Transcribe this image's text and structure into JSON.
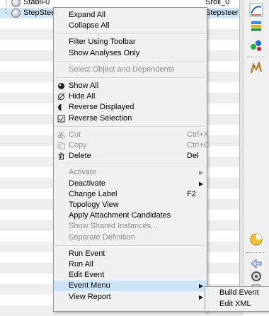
{
  "tree": {
    "rows": [
      {
        "name": "Stabil-0",
        "col": "Sroll_0"
      },
      {
        "name": "StepSteer",
        "col": "Stepsteer"
      }
    ]
  },
  "menu": {
    "groups": [
      [
        {
          "label": "Expand All",
          "enabled": true
        },
        {
          "label": "Collapse All",
          "enabled": true
        }
      ],
      [
        {
          "label": "Filter Using Toolbar",
          "enabled": true
        },
        {
          "label": "Show Analyses Only",
          "enabled": true
        }
      ],
      [
        {
          "label": "Select Object and Dependents",
          "enabled": false
        }
      ],
      [
        {
          "label": "Show All",
          "enabled": true,
          "icon": "show-all-icon"
        },
        {
          "label": "Hide All",
          "enabled": true,
          "icon": "hide-all-icon"
        },
        {
          "label": "Reverse Displayed",
          "enabled": true,
          "icon": "reverse-displayed-icon"
        },
        {
          "label": "Reverse Selection",
          "enabled": true,
          "icon": "reverse-selection-icon"
        }
      ],
      [
        {
          "label": "Cut",
          "enabled": false,
          "shortcut": "Ctrl+X",
          "icon": "scissors-icon"
        },
        {
          "label": "Copy",
          "enabled": false,
          "shortcut": "Ctrl+C",
          "icon": "copy-icon"
        },
        {
          "label": "Delete",
          "enabled": true,
          "shortcut": "Del",
          "icon": "trash-icon"
        }
      ],
      [
        {
          "label": "Activate",
          "enabled": false,
          "submenu": true
        },
        {
          "label": "Deactivate",
          "enabled": true,
          "submenu": true
        },
        {
          "label": "Change Label",
          "enabled": true,
          "shortcut": "F2"
        },
        {
          "label": "Topology View",
          "enabled": true
        },
        {
          "label": "Apply Attachment Candidates",
          "enabled": true
        },
        {
          "label": "Show Shared Instances...",
          "enabled": false
        },
        {
          "label": "Separate Definition",
          "enabled": false
        }
      ],
      [
        {
          "label": "Run Event",
          "enabled": true
        },
        {
          "label": "Run All",
          "enabled": true
        },
        {
          "label": "Edit Event",
          "enabled": true
        },
        {
          "label": "Event Menu",
          "enabled": true,
          "submenu": true,
          "highlighted": true
        },
        {
          "label": "View Report",
          "enabled": true,
          "submenu": true
        }
      ]
    ]
  },
  "submenu": {
    "items": [
      {
        "label": "Build Event"
      },
      {
        "label": "Edit XML"
      }
    ]
  },
  "toolbar": {
    "icons": [
      "curve-plot-icon",
      "stack-icon",
      "molecule-icon",
      "mesh-icon",
      "pie-icon",
      "arrow-left-icon",
      "gear-icon",
      "tool-icon"
    ]
  }
}
